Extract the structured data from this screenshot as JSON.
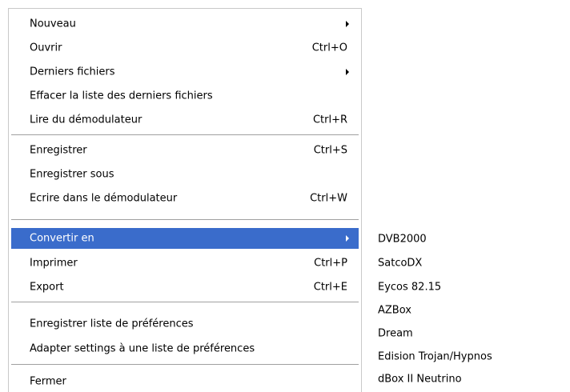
{
  "menu": {
    "items": [
      {
        "label": "Nouveau",
        "shortcut": "",
        "submenu": true
      },
      {
        "label": "Ouvrir",
        "shortcut": "Ctrl+O",
        "submenu": false
      },
      {
        "label": "Derniers fichiers",
        "shortcut": "",
        "submenu": true
      },
      {
        "label": "Effacer la liste des derniers fichiers",
        "shortcut": "",
        "submenu": false
      },
      {
        "label": "Lire du démodulateur",
        "shortcut": "Ctrl+R",
        "submenu": false
      },
      {
        "label": "Enregistrer",
        "shortcut": "Ctrl+S",
        "submenu": false
      },
      {
        "label": "Enregistrer sous",
        "shortcut": "",
        "submenu": false
      },
      {
        "label": "Ecrire dans le démodulateur",
        "shortcut": "Ctrl+W",
        "submenu": false
      },
      {
        "label": "Convertir en",
        "shortcut": "",
        "submenu": true,
        "highlighted": true
      },
      {
        "label": "Imprimer",
        "shortcut": "Ctrl+P",
        "submenu": false
      },
      {
        "label": "Export",
        "shortcut": "Ctrl+E",
        "submenu": false
      },
      {
        "label": "Enregistrer liste de préférences",
        "shortcut": "",
        "submenu": false
      },
      {
        "label": "Adapter settings à une liste de préférences",
        "shortcut": "",
        "submenu": false
      },
      {
        "label": "Fermer",
        "shortcut": "",
        "submenu": false
      }
    ]
  },
  "submenu": {
    "items": [
      {
        "label": "DVB2000"
      },
      {
        "label": "SatcoDX"
      },
      {
        "label": "Eycos 82.15"
      },
      {
        "label": "AZBox"
      },
      {
        "label": "Dream"
      },
      {
        "label": "Edision Trojan/Hypnos"
      },
      {
        "label": "dBox II Neutrino"
      }
    ]
  },
  "colors": {
    "highlight": "#3a6ccb",
    "highlight_text": "#ffffff",
    "separator": "#a0a0a0"
  }
}
